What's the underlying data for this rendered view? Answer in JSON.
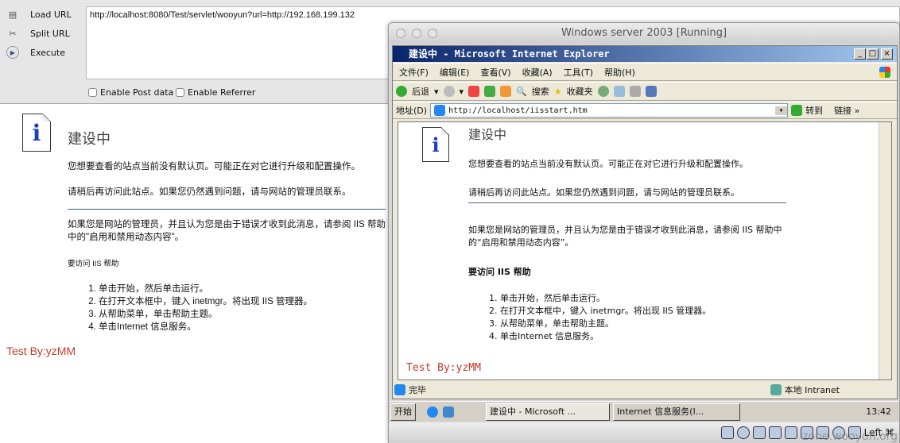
{
  "hackbar": {
    "load_url": "Load URL",
    "split_url": "Split URL",
    "execute": "Execute",
    "url": "http://localhost:8080/Test/servlet/wooyun?url=http://192.168.199.132",
    "enable_post": "Enable Post data",
    "enable_referrer": "Enable Referrer"
  },
  "page": {
    "title": "建设中",
    "p1": "您想要查看的站点当前没有默认页。可能正在对它进行升级和配置操作。",
    "p2": "请稍后再访问此站点。如果您仍然遇到问题，请与网站的管理员联系。",
    "p3": "如果您是网站的管理员，并且认为您是由于错误才收到此消息，请参阅 IIS 帮助中的\"启用和禁用动态内容\"。",
    "help_title": "要访问 IIS 帮助",
    "steps": [
      "单击开始，然后单击运行。",
      "在打开文本框中，键入 inetmgr。将出现 IIS 管理器。",
      "从帮助菜单，单击帮助主题。",
      "单击Internet 信息服务。"
    ],
    "footer": "Test By:yzMM"
  },
  "vm": {
    "title": "Windows server 2003 [Running]",
    "status_right": "Left ⌘",
    "watermark": "zone.wooyun.org"
  },
  "ie": {
    "title": "建设中 - Microsoft Internet Explorer",
    "menu": [
      "文件(F)",
      "编辑(E)",
      "查看(V)",
      "收藏(A)",
      "工具(T)",
      "帮助(H)"
    ],
    "back": "后退",
    "search": "搜索",
    "favorites": "收藏夹",
    "address_label": "地址(D)",
    "address": "http://localhost/iisstart.htm",
    "go": "转到",
    "links": "链接 »",
    "status": "完毕",
    "zone": "本地 Intranet",
    "page": {
      "title": "建设中",
      "p1": "您想要查看的站点当前没有默认页。可能正在对它进行升级和配置操作。",
      "p2": "请稍后再访问此站点。如果您仍然遇到问题，请与网站的管理员联系。",
      "p3": "如果您是网站的管理员，并且认为您是由于错误才收到此消息，请参阅 IIS 帮助中的“启用和禁用动态内容”。",
      "help_title": "要访问 IIS 帮助",
      "steps": [
        "单击开始，然后单击运行。",
        "在打开文本框中，键入 inetmgr。将出现 IIS 管理器。",
        "从帮助菜单，单击帮助主题。",
        "单击Internet 信息服务。"
      ],
      "footer": "Test By:yzMM"
    }
  },
  "taskbar": {
    "start": "开始",
    "task1": "建设中 - Microsoft ...",
    "task2": "Internet 信息服务(I...",
    "clock": "13:42"
  },
  "colors": {
    "footer": "#c0392b",
    "ie_title": "#0a246a"
  }
}
